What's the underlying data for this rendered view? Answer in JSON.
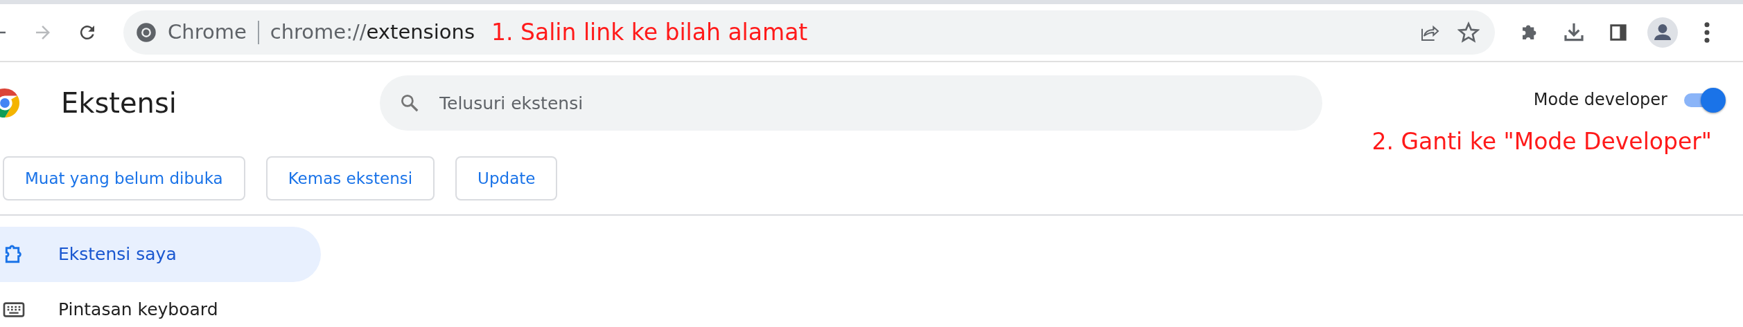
{
  "toolbar": {
    "omnibox": {
      "site_label": "Chrome",
      "url_scheme": "chrome://",
      "url_path": "extensions"
    }
  },
  "annotations": [
    {
      "text": "1. Salin link ke bilah alamat"
    },
    {
      "text": "2. Ganti ke \"Mode Developer\""
    }
  ],
  "header": {
    "title": "Ekstensi",
    "search": {
      "placeholder": "Telusuri ekstensi"
    },
    "developer_mode": {
      "label": "Mode developer",
      "on": true
    }
  },
  "actions": [
    "Muat yang belum dibuka",
    "Kemas ekstensi",
    "Update"
  ],
  "sidebar": {
    "items": [
      {
        "label": "Ekstensi saya",
        "kind": "extensions",
        "selected": true
      },
      {
        "label": "Pintasan keyboard",
        "kind": "keyboard",
        "selected": false
      }
    ]
  }
}
